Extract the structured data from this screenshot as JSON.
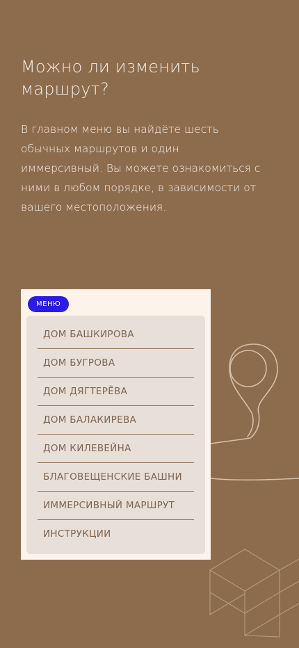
{
  "heading": "Можно ли изменить маршрут?",
  "description": "В главном меню вы найдёте шесть обычных маршрутов и один иммерсивный. Вы можете ознакомиться с ними в любом порядке, в зависимости от вашего местоположения.",
  "menu": {
    "badge_label": "МЕНЮ",
    "items": [
      {
        "label": "ДОМ БАШКИРОВА"
      },
      {
        "label": "ДОМ БУГРОВА"
      },
      {
        "label": "ДОМ ДЯГТЕРЁВА"
      },
      {
        "label": "ДОМ БАЛАКИРЕВА"
      },
      {
        "label": "ДОМ КИЛЕВЕЙНА"
      },
      {
        "label": "БЛАГОВЕЩЕНСКИЕ БАШНИ"
      },
      {
        "label": "ИММЕРСИВНЫЙ МАРШРУТ"
      },
      {
        "label": "ИНСТРУКЦИИ"
      }
    ]
  },
  "colors": {
    "background": "#8D6C4E",
    "text": "#F6EEE6",
    "card": "#FCF4EB",
    "panel": "#E8E0D8",
    "accent": "#2A1CE6",
    "item_text": "#7E6451"
  },
  "icons": {
    "map_pin": "map-pin-icon",
    "tiles": "isometric-tiles-decoration"
  }
}
